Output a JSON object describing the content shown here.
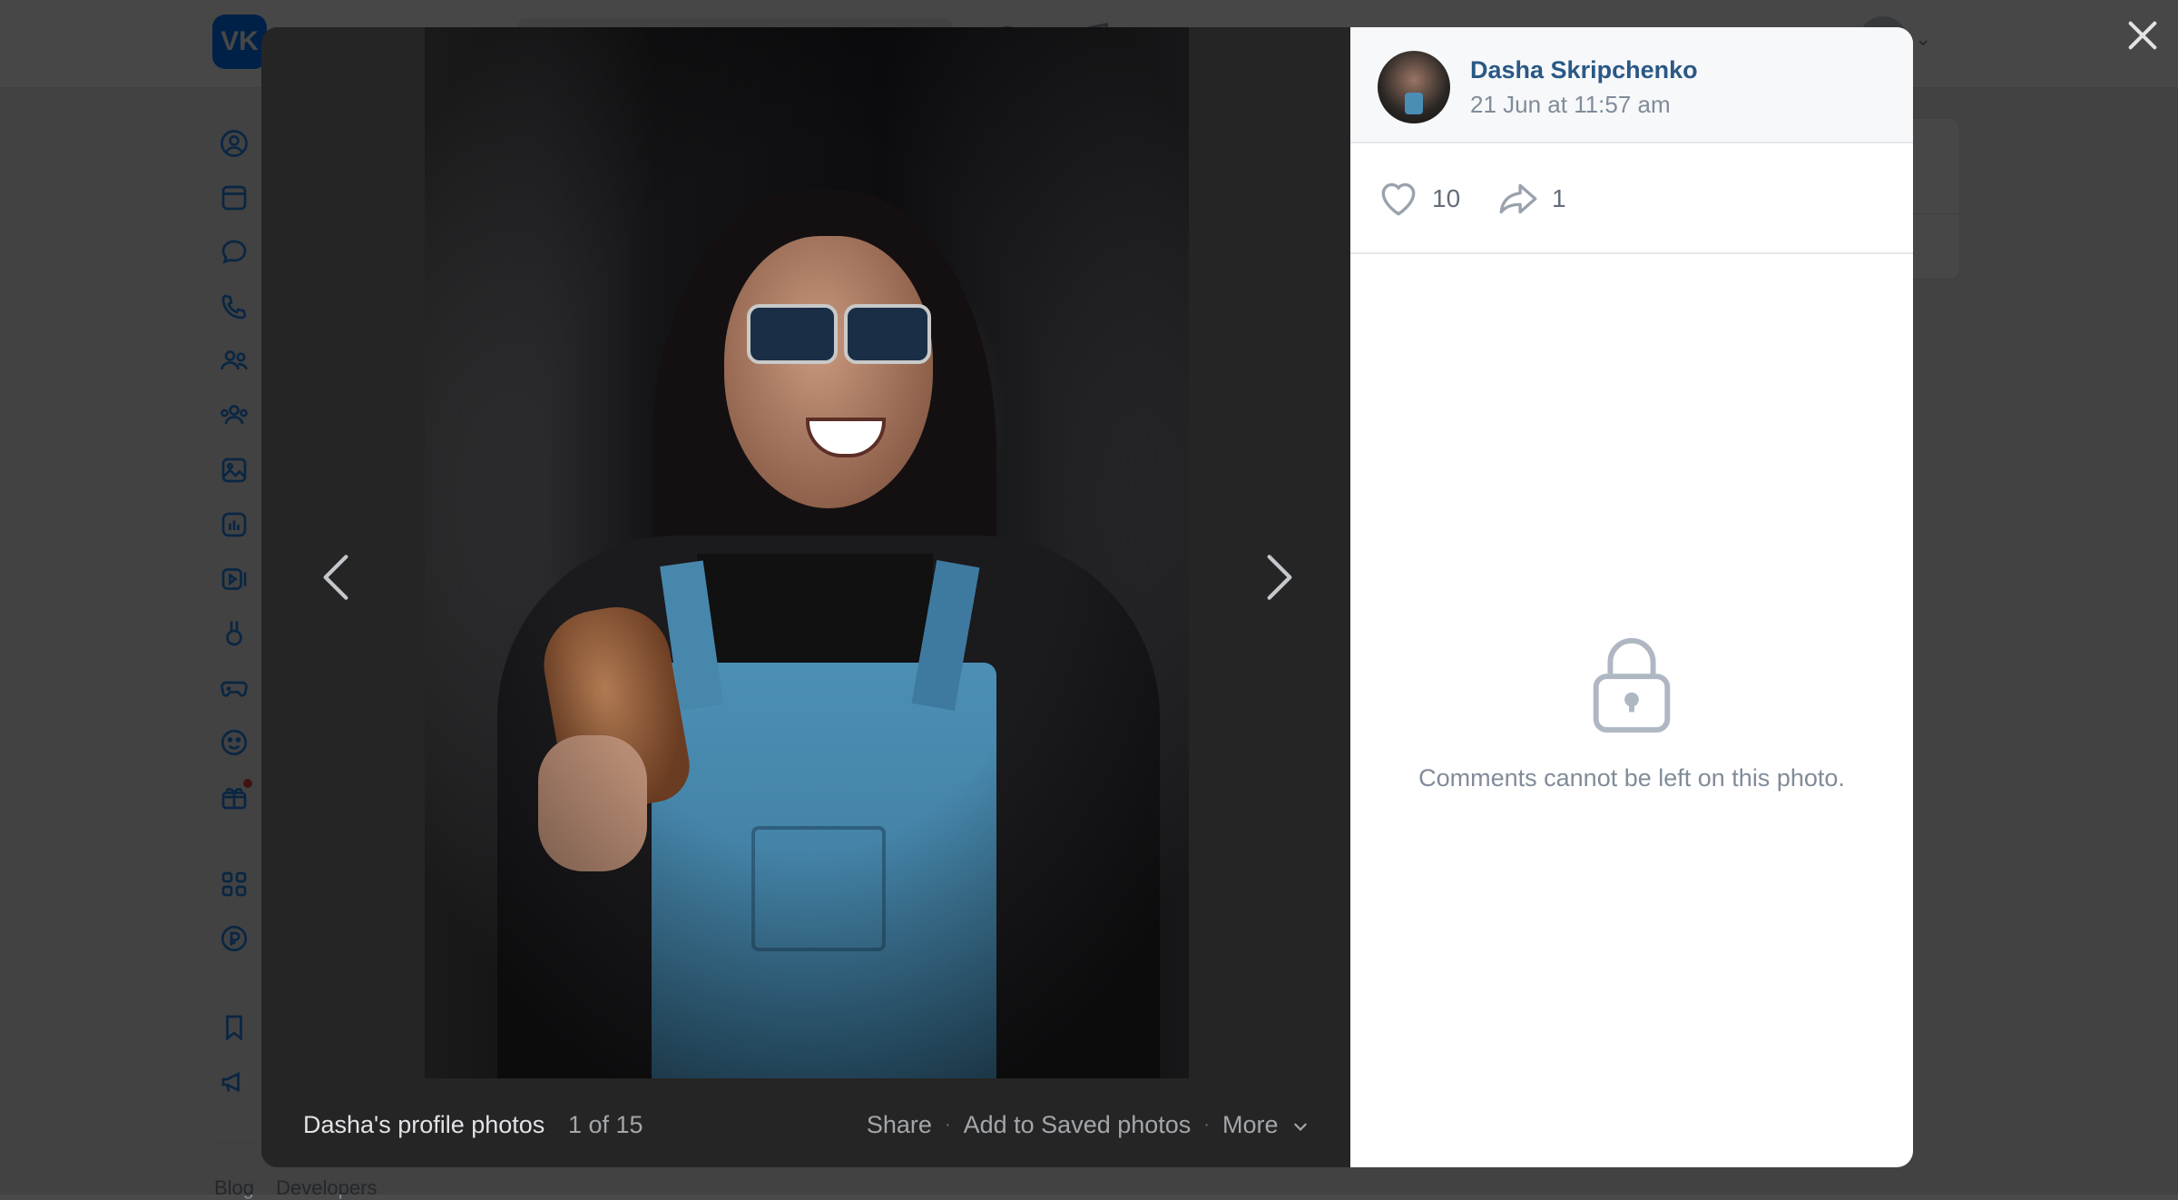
{
  "background": {
    "logo_text": "VK",
    "footer_links": [
      "Blog",
      "Developers"
    ],
    "sidebar_icons": [
      "profile-icon",
      "news-icon",
      "messenger-icon",
      "calls-icon",
      "friends-icon",
      "communities-icon",
      "photos-icon",
      "music-icon",
      "video-icon",
      "clips-icon",
      "games-icon",
      "stickers-icon",
      "gifts-icon",
      "services-icon",
      "payments-icon",
      "bookmarks-icon",
      "ads-icon"
    ]
  },
  "viewer": {
    "album_title": "Dasha's profile photos",
    "counter": "1 of 15",
    "actions": {
      "share": "Share",
      "save": "Add to Saved photos",
      "more": "More"
    }
  },
  "panel": {
    "author_name": "Dasha Skripchenko",
    "date": "21 Jun at 11:57 am",
    "likes": "10",
    "shares": "1",
    "comments_notice": "Comments cannot be left on this photo."
  },
  "colors": {
    "accent": "#2a5885",
    "brand": "#0077ff",
    "notification": "#e64646"
  }
}
